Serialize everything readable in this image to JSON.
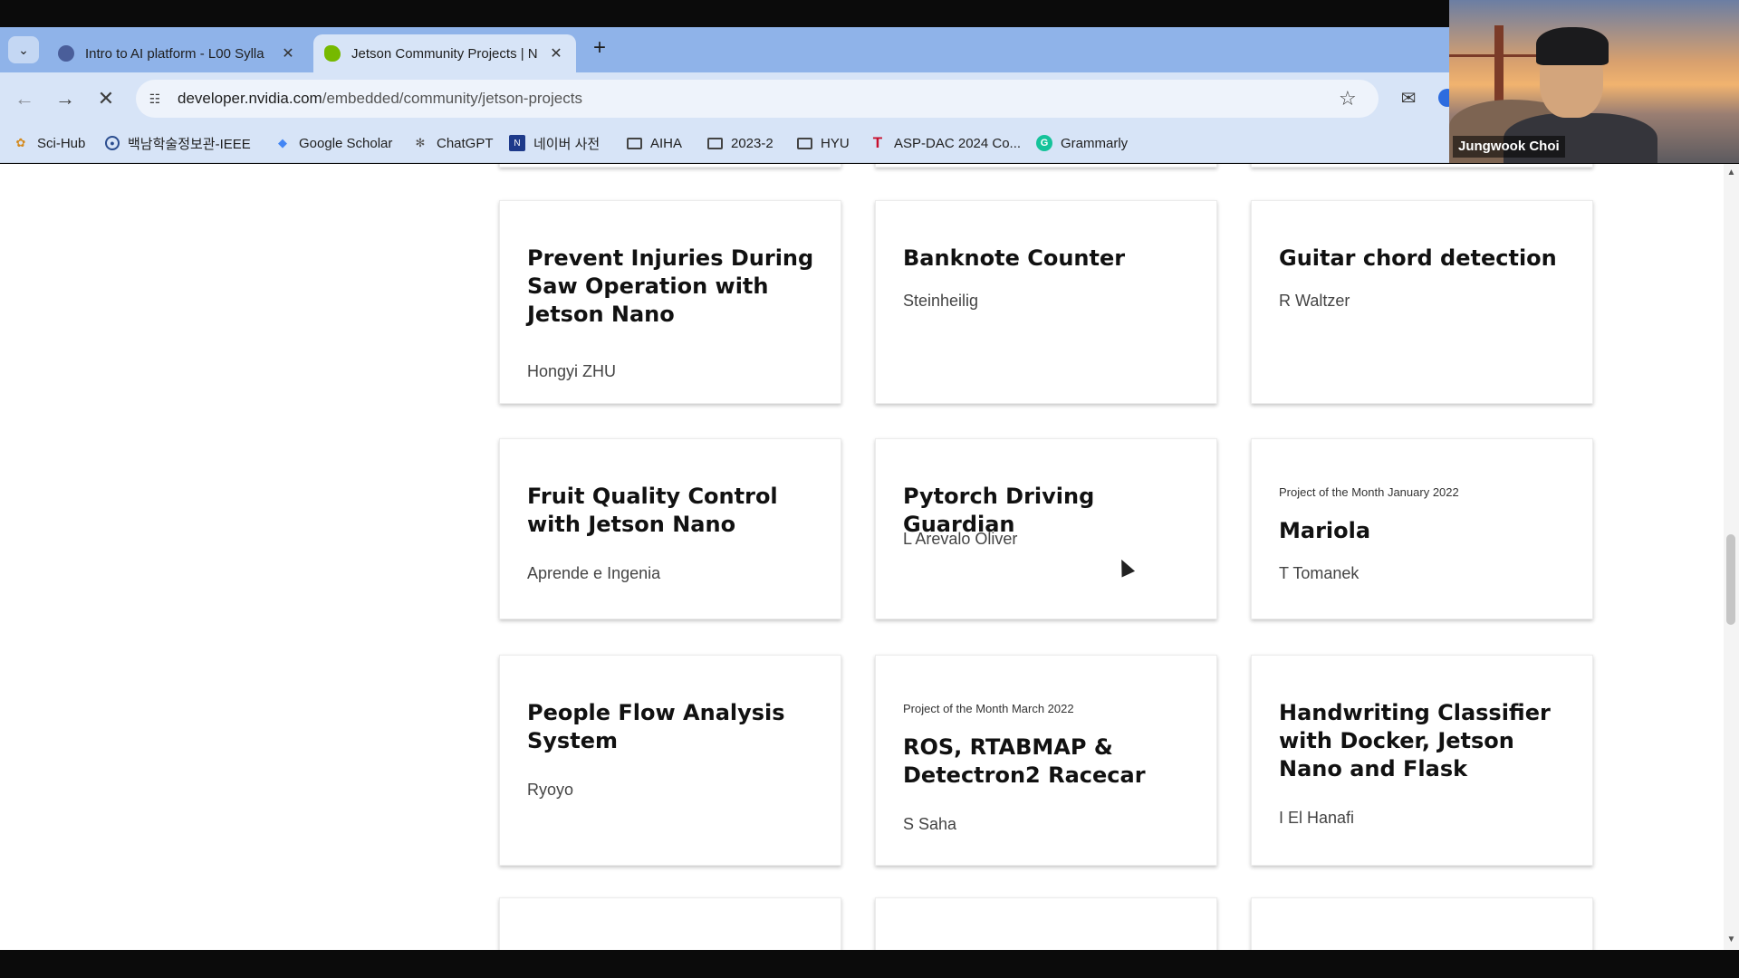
{
  "browser": {
    "tabs": [
      {
        "title": "Intro to AI platform - L00 Sylla",
        "favicon_color": "#4a5e9a",
        "active": false
      },
      {
        "title": "Jetson Community Projects | N",
        "favicon_color": "#76b900",
        "active": true
      }
    ],
    "url_domain": "developer.nvidia.com",
    "url_path": "/embedded/community/jetson-projects",
    "bookmarks": [
      {
        "label": "Sci-Hub",
        "icon": "sci-hub-icon"
      },
      {
        "label": "백남학술정보관-IEEE",
        "icon": "library-icon"
      },
      {
        "label": "Google Scholar",
        "icon": "scholar-icon"
      },
      {
        "label": "ChatGPT",
        "icon": "chatgpt-icon"
      },
      {
        "label": "네이버 사전",
        "icon": "naver-dictionary-icon"
      },
      {
        "label": "AIHA",
        "icon": "folder-icon"
      },
      {
        "label": "2023-2",
        "icon": "folder-icon"
      },
      {
        "label": "HYU",
        "icon": "folder-icon"
      },
      {
        "label": "ASP-DAC 2024 Co...",
        "icon": "aspdac-icon"
      },
      {
        "label": "Grammarly",
        "icon": "grammarly-icon"
      }
    ]
  },
  "webcam": {
    "participant_name": "Jungwook Choi"
  },
  "cards": [
    {
      "title": "Prevent Injuries During Saw Operation with Jetson Nano",
      "author": "Hongyi ZHU",
      "badge": ""
    },
    {
      "title": "Banknote Counter",
      "author": "Steinheilig",
      "badge": ""
    },
    {
      "title": "Guitar chord detection",
      "author": "R Waltzer",
      "badge": ""
    },
    {
      "title": "Fruit Quality Control with Jetson Nano",
      "author": "Aprende e Ingenia",
      "badge": ""
    },
    {
      "title": "Pytorch Driving Guardian",
      "author": "L Arevalo Oliver",
      "badge": ""
    },
    {
      "title": "Mariola",
      "author": "T Tomanek",
      "badge": "Project of the Month January 2022"
    },
    {
      "title": "People Flow Analysis System",
      "author": "Ryoyo",
      "badge": ""
    },
    {
      "title": "ROS, RTABMAP & Detectron2 Racecar",
      "author": "S Saha",
      "badge": "Project of the Month March 2022"
    },
    {
      "title": "Handwriting Classifier with Docker, Jetson Nano and Flask",
      "author": "I El Hanafi",
      "badge": ""
    }
  ]
}
